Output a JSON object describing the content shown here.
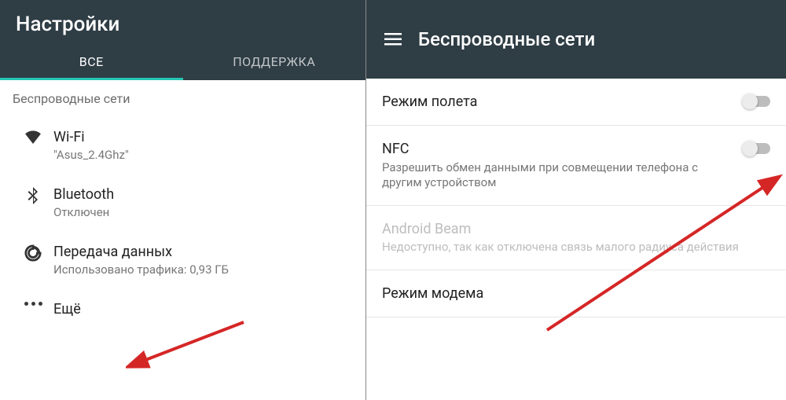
{
  "left": {
    "title": "Настройки",
    "tabs": {
      "all": "ВСЕ",
      "support": "ПОДДЕРЖКА"
    },
    "section": "Беспроводные сети",
    "items": {
      "wifi": {
        "title": "Wi-Fi",
        "sub": "\"Asus_2.4Ghz\""
      },
      "bt": {
        "title": "Bluetooth",
        "sub": "Отключен"
      },
      "data": {
        "title": "Передача данных",
        "sub": "Использовано трафика: 0,93 ГБ"
      },
      "more": {
        "title": "Ещё"
      }
    }
  },
  "right": {
    "title": "Беспроводные сети",
    "items": {
      "airplane": {
        "title": "Режим полета"
      },
      "nfc": {
        "title": "NFC",
        "sub": "Разрешить обмен данными при совмещении телефона с другим устройством"
      },
      "beam": {
        "title": "Android Beam",
        "sub": "Недоступно, так как отключена связь малого радиуса действия"
      },
      "tether": {
        "title": "Режим модема"
      }
    }
  },
  "colors": {
    "accent": "#26c6b4",
    "header": "#2f3d45",
    "arrow": "#d52626"
  }
}
